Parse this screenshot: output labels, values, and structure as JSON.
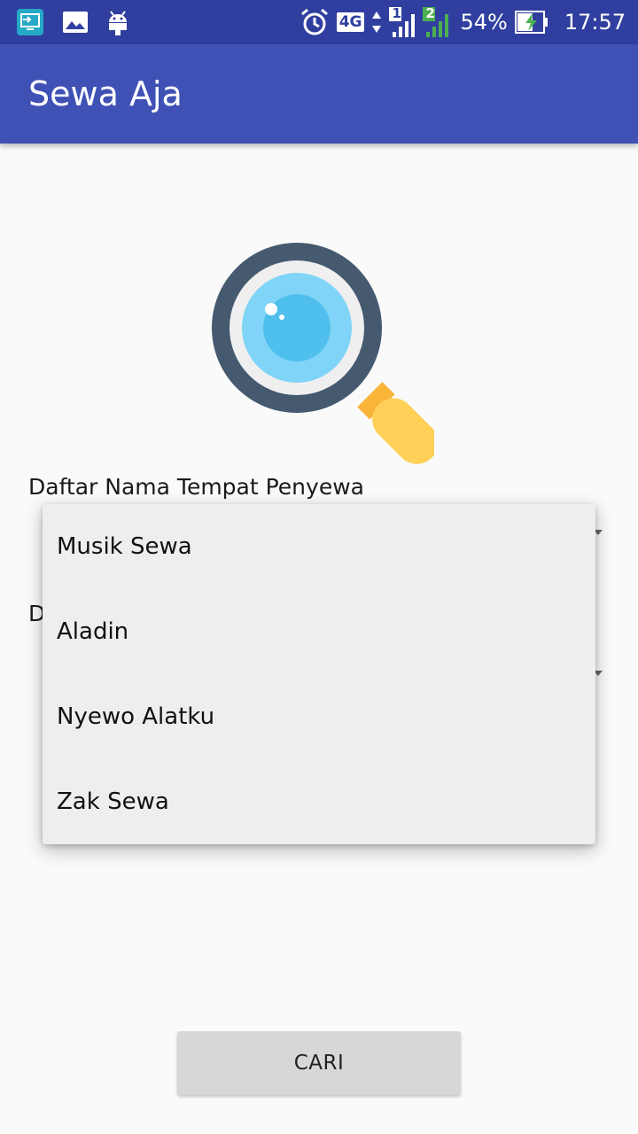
{
  "status_bar": {
    "network": "4G",
    "sim1": "1",
    "sim2": "2",
    "battery": "54%",
    "time": "17:57",
    "icons": [
      "screen-cast-icon",
      "image-icon",
      "android-icon",
      "alarm-icon",
      "signal-icon",
      "battery-charging-icon"
    ],
    "colors": {
      "background": "#303f9f",
      "sim2_signal": "#4caf50"
    }
  },
  "app_bar": {
    "title": "Sewa Aja",
    "color": "#3f51b5"
  },
  "form": {
    "rental_place_label": "Daftar Nama Tempat Penyewa",
    "second_label_visible_char": "D"
  },
  "dropdown": {
    "options": [
      "Musik Sewa",
      "Aladin",
      "Nyewo Alatku",
      "Zak Sewa"
    ]
  },
  "actions": {
    "search_button_label": "CARI"
  }
}
